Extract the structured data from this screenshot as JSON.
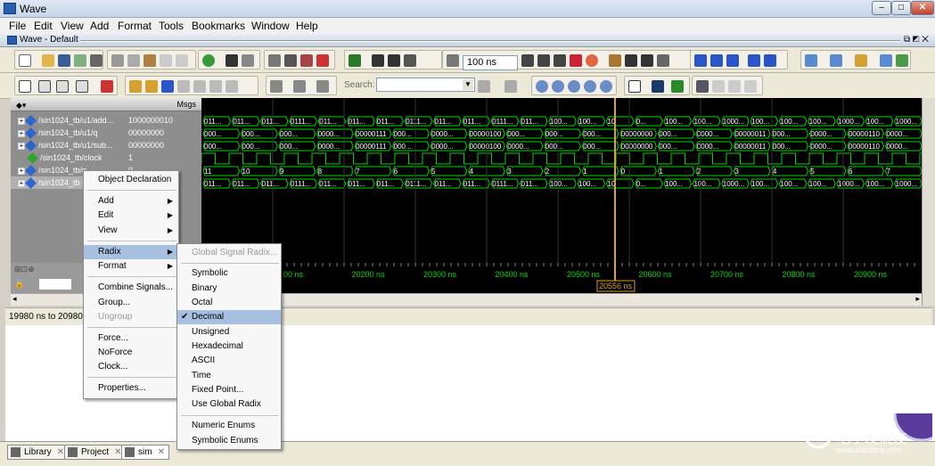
{
  "window": {
    "title": "Wave"
  },
  "menubar": [
    "File",
    "Edit",
    "View",
    "Add",
    "Format",
    "Tools",
    "Bookmarks",
    "Window",
    "Help"
  ],
  "wave_window": {
    "title": "Wave - Default"
  },
  "toolbar": {
    "time_value": "100",
    "time_unit": "ns",
    "search_label": "Search:",
    "search_value": ""
  },
  "columns": {
    "msgs": "Msgs"
  },
  "signals": [
    {
      "name": "/sin1024_tb/u1/add...",
      "value": "1000000010",
      "expandable": true
    },
    {
      "name": "/sin1024_tb/u1/q",
      "value": "00000000",
      "expandable": true
    },
    {
      "name": "/sin1024_tb/u1/sub...",
      "value": "00000000",
      "expandable": true
    },
    {
      "name": "/sin1024_tb/clock",
      "value": "1",
      "expandable": false
    },
    {
      "name": "/sin1024_tb/q",
      "value": "0",
      "expandable": true
    },
    {
      "name": "/sin1024_tb",
      "value": "",
      "expandable": true
    }
  ],
  "wave_labels": {
    "row0": [
      "011...",
      "011...",
      "011...",
      "0111...",
      "011...",
      "011...",
      "011...",
      "0111...",
      "011...",
      "011...",
      "0111...",
      "011...",
      "100...",
      "100...",
      "10",
      "0...",
      "100...",
      "100...",
      "1000...",
      "100...",
      "100...",
      "100...",
      "1000...",
      "100...",
      "1000..."
    ],
    "row1": [
      "000...",
      "000...",
      "000...",
      "0000...",
      "00000111",
      "000...",
      "0000...",
      "00000100",
      "000...",
      "000...",
      "000...",
      "00000000",
      "000...",
      "0000...",
      "00000011",
      "000...",
      "0000...",
      "00000110",
      "0000..."
    ],
    "row2": [
      "000...",
      "000...",
      "000...",
      "0000...",
      "00000111",
      "000...",
      "0000...",
      "00000100",
      "0000...",
      "000...",
      "000...",
      "00000000",
      "000...",
      "0000...",
      "00000011",
      "000...",
      "0000...",
      "00000110",
      "0000..."
    ],
    "row4": [
      "11",
      "10",
      "9",
      "8",
      "7",
      "6",
      "5",
      "4",
      "3",
      "2",
      "1",
      "0",
      "1",
      "2",
      "3",
      "4",
      "5",
      "6",
      "7"
    ],
    "row5": [
      "011...",
      "011...",
      "011...",
      "0111...",
      "011...",
      "011...",
      "011...",
      "0111...",
      "011...",
      "011...",
      "0111...",
      "011...",
      "100...",
      "100...",
      "10",
      "0...",
      "100...",
      "100...",
      "1000...",
      "100...",
      "100...",
      "100...",
      "1000...",
      "100...",
      "1000..."
    ]
  },
  "timeline": {
    "ticks": [
      "00 ns",
      "20200 ns",
      "20300 ns",
      "20400 ns",
      "20500 ns",
      "20600 ns",
      "20700 ns",
      "20800 ns",
      "20900 ns"
    ],
    "cursor": "20556 ns"
  },
  "status": {
    "range": "19980 ns to 20980 ns"
  },
  "context_menu": {
    "items": [
      "Object Declaration",
      "Add",
      "Edit",
      "View",
      "Radix",
      "Format",
      "Combine Signals...",
      "Group...",
      "Ungroup",
      "Force...",
      "NoForce",
      "Clock...",
      "Properties..."
    ]
  },
  "radix_menu": {
    "items": [
      "Global Signal Radix...",
      "Symbolic",
      "Binary",
      "Octal",
      "Decimal",
      "Unsigned",
      "Hexadecimal",
      "ASCII",
      "Time",
      "Fixed Point...",
      "Use Global Radix",
      "Numeric Enums",
      "Symbolic Enums"
    ],
    "checked": "Decimal"
  },
  "bottom_tabs": [
    "Library",
    "Project",
    "sim"
  ],
  "watermark": {
    "text": "电子发烧友",
    "url": "www.elecfans.com"
  },
  "colors": {
    "wave_green": "#00d800",
    "cursor": "#e0a020",
    "highlight": "#a7c0e0"
  }
}
